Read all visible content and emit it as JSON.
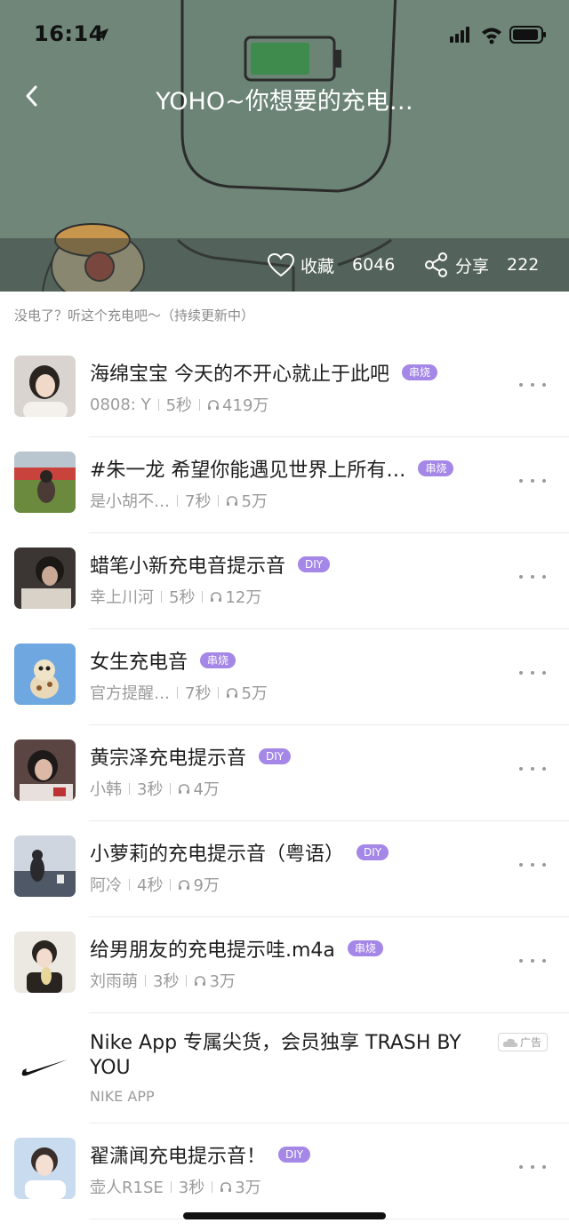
{
  "status_bar": {
    "time": "16:14"
  },
  "nav": {
    "title": "YOHO~你想要的充电…"
  },
  "actions": {
    "favorite_label": "收藏",
    "favorite_count": "6046",
    "share_label": "分享",
    "share_count": "222"
  },
  "description": "没电了？听这个充电吧～（持续更新中）",
  "colors": {
    "tag_bg": "#a487e6",
    "banner_bg": "#6f8679"
  },
  "items": [
    {
      "title": "海绵宝宝 今天的不开心就止于此吧",
      "tag": "串烧",
      "author": "0808: Y",
      "duration": "5秒",
      "plays": "419万"
    },
    {
      "title": "#朱一龙 希望你能遇见世界上所有…",
      "tag": "串烧",
      "author": "是小胡不…",
      "duration": "7秒",
      "plays": "5万"
    },
    {
      "title": "蜡笔小新充电音提示音",
      "tag": "DIY",
      "author": "幸上川河",
      "duration": "5秒",
      "plays": "12万"
    },
    {
      "title": "女生充电音",
      "tag": "串烧",
      "author": "官方提醒…",
      "duration": "7秒",
      "plays": "5万"
    },
    {
      "title": "黄宗泽充电提示音",
      "tag": "DIY",
      "author": "小韩",
      "duration": "3秒",
      "plays": "4万"
    },
    {
      "title": "小萝莉的充电提示音（粤语）",
      "tag": "DIY",
      "author": "阿冷",
      "duration": "4秒",
      "plays": "9万"
    },
    {
      "title": "给男朋友的充电提示哇.m4a",
      "tag": "串烧",
      "author": "刘雨萌",
      "duration": "3秒",
      "plays": "3万"
    }
  ],
  "ad": {
    "title": "Nike App 专属尖货，会员独享 TRASH BY YOU",
    "subtitle": "NIKE APP",
    "badge": "广告"
  },
  "last_item": {
    "title": "翟潇闻充电提示音！",
    "tag": "DIY",
    "author": "壶人R1SE",
    "duration": "3秒",
    "plays": "3万"
  }
}
